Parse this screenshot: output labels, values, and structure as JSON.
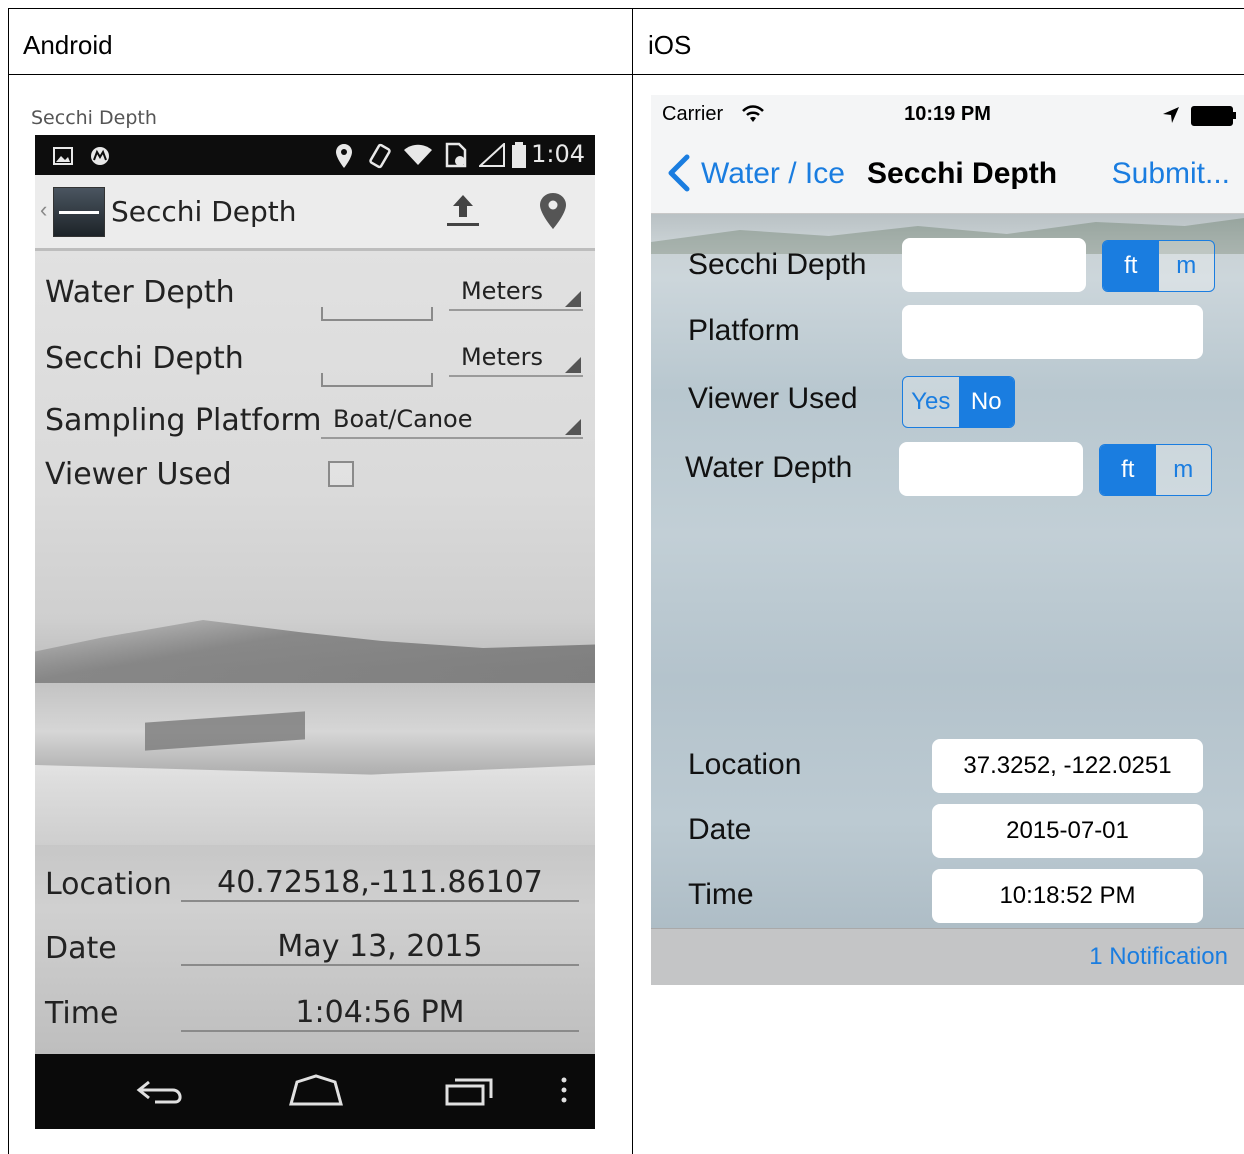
{
  "table": {
    "col_android": "Android",
    "col_ios": "iOS"
  },
  "android": {
    "caption": "Secchi Depth",
    "status_time": "1:04",
    "title": "Secchi Depth",
    "fields": {
      "water_depth_label": "Water Depth",
      "water_depth_unit": "Meters",
      "secchi_depth_label": "Secchi Depth",
      "secchi_depth_unit": "Meters",
      "platform_label": "Sampling Platform",
      "platform_value": "Boat/Canoe",
      "viewer_label": "Viewer Used",
      "location_label": "Location",
      "location_value": "40.72518,-111.86107",
      "date_label": "Date",
      "date_value": "May 13, 2015",
      "time_label": "Time",
      "time_value": "1:04:56 PM"
    }
  },
  "ios": {
    "carrier": "Carrier",
    "status_time": "10:19 PM",
    "back_label": "Water / Ice",
    "title": "Secchi Depth",
    "submit_label": "Submit...",
    "fields": {
      "secchi_depth_label": "Secchi Depth",
      "platform_label": "Platform",
      "viewer_label": "Viewer Used",
      "water_depth_label": "Water Depth",
      "unit_ft": "ft",
      "unit_m": "m",
      "yes": "Yes",
      "no": "No",
      "location_label": "Location",
      "location_value": "37.3252, -122.0251",
      "date_label": "Date",
      "date_value": "2015-07-01",
      "time_label": "Time",
      "time_value": "10:18:52 PM"
    },
    "notification": "1 Notification",
    "accent_color": "#1a7de0"
  }
}
